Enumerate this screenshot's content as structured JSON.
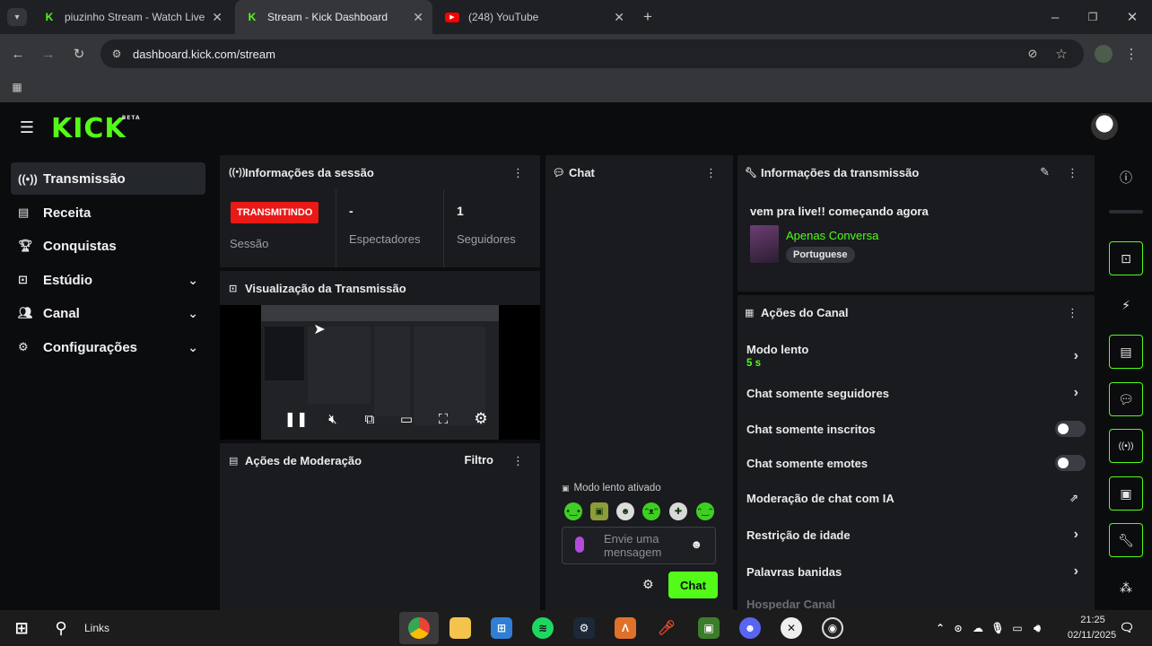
{
  "browser": {
    "tabs": [
      {
        "title": "piuzinho Stream - Watch Live o",
        "favicon": "kick-icon",
        "active": false
      },
      {
        "title": "Stream - Kick Dashboard",
        "favicon": "kick-icon",
        "active": true
      },
      {
        "title": "(248) YouTube",
        "favicon": "youtube-icon",
        "active": false
      }
    ],
    "url": "dashboard.kick.com/stream"
  },
  "app": {
    "logo": "KICK",
    "logo_badge": "BETA"
  },
  "sidebar": {
    "items": [
      {
        "label": "Transmissão",
        "icon": "broadcast-icon",
        "active": true
      },
      {
        "label": "Receita",
        "icon": "chart-icon"
      },
      {
        "label": "Conquistas",
        "icon": "trophy-icon"
      },
      {
        "label": "Estúdio",
        "icon": "studio-icon",
        "expandable": true
      },
      {
        "label": "Canal",
        "icon": "users-icon",
        "expandable": true
      },
      {
        "label": "Configurações",
        "icon": "gear-icon",
        "expandable": true
      }
    ]
  },
  "session": {
    "title": "Informações da sessão",
    "live_badge": "TRANSMITINDO",
    "session_label": "Sessão",
    "viewers_value": "-",
    "viewers_label": "Espectadores",
    "followers_value": "1",
    "followers_label": "Seguidores"
  },
  "preview": {
    "title": "Visualização da Transmissão"
  },
  "moderation": {
    "title": "Ações de Moderação",
    "filter_label": "Filtro"
  },
  "chat": {
    "title": "Chat",
    "slow_mode_notice": "Modo lento ativado",
    "input_placeholder": "Envie uma mensagem",
    "send_label": "Chat"
  },
  "stream_info": {
    "title": "Informações da transmissão",
    "stream_title": "vem pra live!! começando agora",
    "category": "Apenas Conversa",
    "language": "Portuguese"
  },
  "channel_actions": {
    "title": "Ações do Canal",
    "rows": [
      {
        "label": "Modo lento",
        "sub": "5 s",
        "control": "chevron"
      },
      {
        "label": "Chat somente seguidores",
        "control": "chevron"
      },
      {
        "label": "Chat somente inscritos",
        "control": "toggle",
        "on": false
      },
      {
        "label": "Chat somente emotes",
        "control": "toggle",
        "on": false
      },
      {
        "label": "Moderação de chat com IA",
        "control": "external"
      },
      {
        "label": "Restrição de idade",
        "control": "chevron"
      },
      {
        "label": "Palavras banidas",
        "control": "chevron"
      },
      {
        "label": "Hospedar Canal",
        "control": "none"
      }
    ]
  },
  "taskbar": {
    "search_label": "Links",
    "time": "21:25",
    "date": "02/11/2025"
  },
  "colors": {
    "brand": "#53fc18",
    "live": "#e91916",
    "panel": "#191b1f"
  }
}
